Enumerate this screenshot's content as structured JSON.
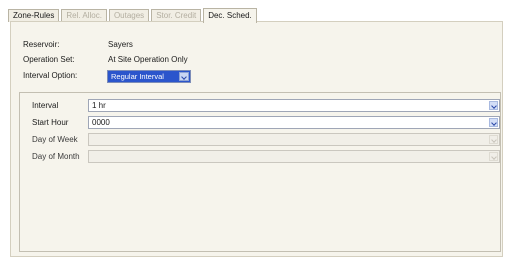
{
  "tabs": [
    {
      "label": "Zone-Rules",
      "state": "enabled"
    },
    {
      "label": "Rel. Alloc.",
      "state": "disabled"
    },
    {
      "label": "Outages",
      "state": "disabled"
    },
    {
      "label": "Stor. Credit",
      "state": "disabled"
    },
    {
      "label": "Dec. Sched.",
      "state": "active"
    }
  ],
  "info": {
    "reservoir_label": "Reservoir:",
    "reservoir_value": "Sayers",
    "operation_set_label": "Operation Set:",
    "operation_set_value": "At Site Operation Only",
    "interval_option_label": "Interval Option:",
    "interval_option_value": "Regular Interval"
  },
  "schedule": {
    "interval_label": "Interval",
    "interval_value": "1 hr",
    "start_hour_label": "Start Hour",
    "start_hour_value": "0000",
    "day_of_week_label": "Day of Week",
    "day_of_week_value": "",
    "day_of_month_label": "Day of Month",
    "day_of_month_value": ""
  },
  "icons": {
    "dropdown": "chevron-down-icon"
  },
  "colors": {
    "selected_combo": "#2b55cc",
    "panel_background": "#f6f4ec",
    "disabled_tab_text": "#b3aea0"
  }
}
